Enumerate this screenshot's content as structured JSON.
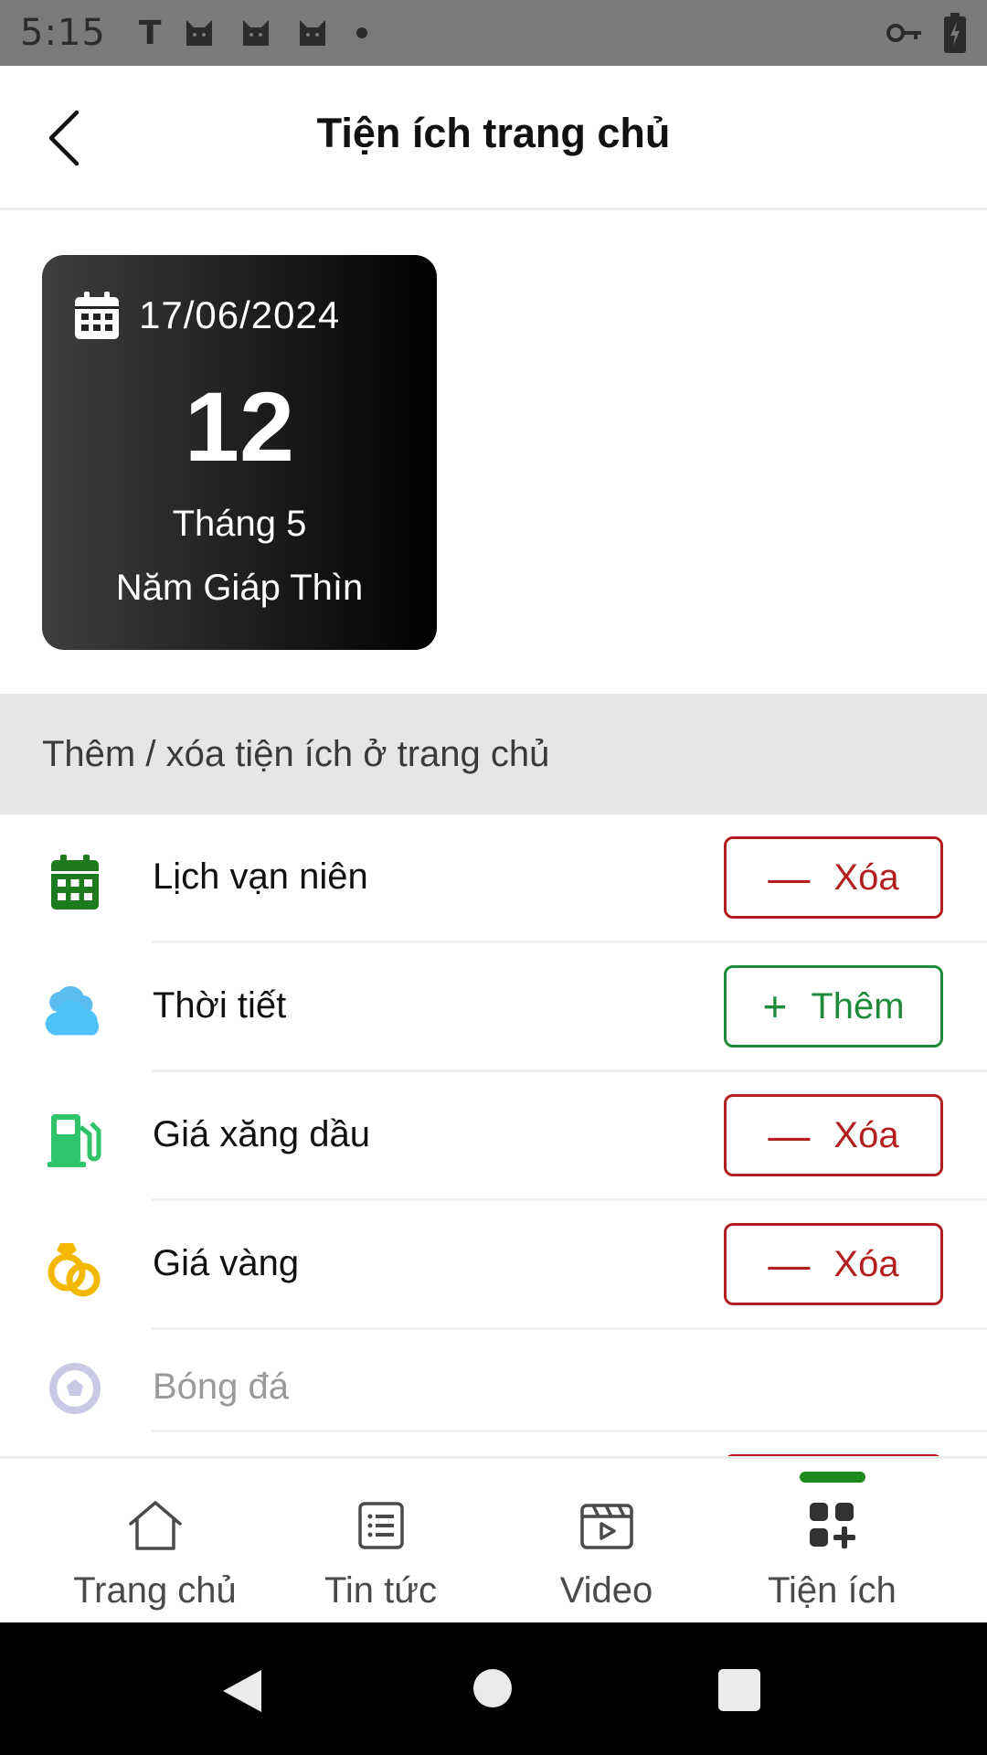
{
  "status_bar": {
    "time": "5:15",
    "notification_letter": "T",
    "icons": [
      "cat-icon",
      "cat-icon",
      "cat-icon",
      "dot-icon",
      "vpn-key-icon",
      "battery-charging-icon"
    ]
  },
  "header": {
    "title": "Tiện ích trang chủ",
    "back_icon": "chevron-left-icon"
  },
  "calendar_card": {
    "date": "17/06/2024",
    "lunar_day": "12",
    "lunar_month": "Tháng 5",
    "lunar_year": "Năm Giáp Thìn"
  },
  "section": {
    "title": "Thêm / xóa tiện ích ở trang chủ"
  },
  "utilities": [
    {
      "label": "Lịch vạn niên",
      "icon": "calendar-icon",
      "action": "Xóa",
      "action_type": "remove"
    },
    {
      "label": "Thời tiết",
      "icon": "cloud-icon",
      "action": "Thêm",
      "action_type": "add"
    },
    {
      "label": "Giá xăng dầu",
      "icon": "fuel-pump-icon",
      "action": "Xóa",
      "action_type": "remove"
    },
    {
      "label": "Giá vàng",
      "icon": "gold-rings-icon",
      "action": "Xóa",
      "action_type": "remove"
    },
    {
      "label": "Bóng đá",
      "icon": "soccer-ball-icon",
      "action": "",
      "action_type": "disabled"
    }
  ],
  "bottom_nav": {
    "items": [
      {
        "label": "Trang chủ",
        "icon": "home-icon"
      },
      {
        "label": "Tin tức",
        "icon": "news-list-icon"
      },
      {
        "label": "Video",
        "icon": "video-clapper-icon"
      },
      {
        "label": "Tiện ích",
        "icon": "apps-add-icon",
        "active": true
      }
    ]
  },
  "colors": {
    "remove": "#b21f1f",
    "add": "#1e8a3a",
    "active_indicator": "#1e8a1e",
    "section_bg": "#e6e6e6"
  }
}
